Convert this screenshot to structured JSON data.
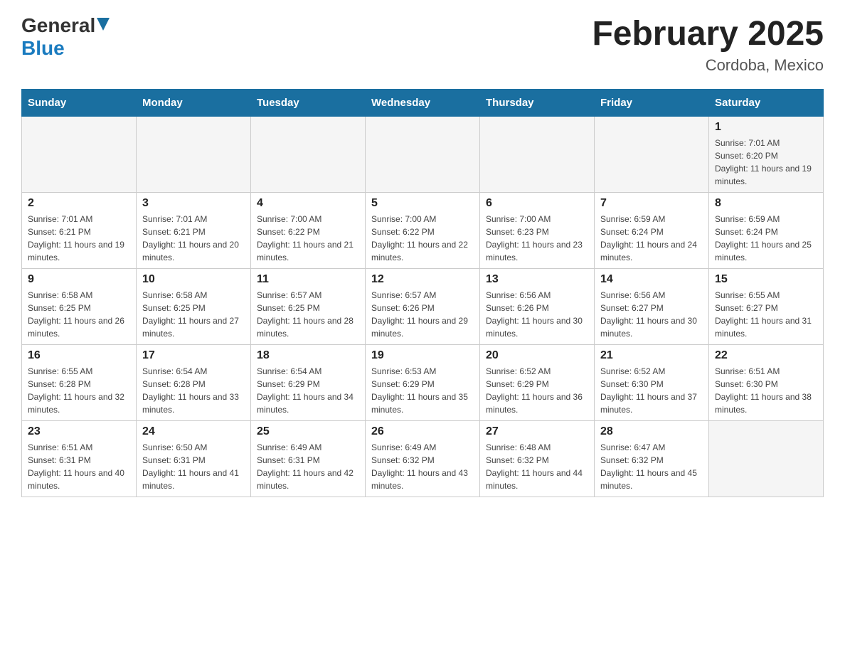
{
  "header": {
    "logo_general": "General",
    "logo_blue": "Blue",
    "title": "February 2025",
    "subtitle": "Cordoba, Mexico"
  },
  "days_of_week": [
    "Sunday",
    "Monday",
    "Tuesday",
    "Wednesday",
    "Thursday",
    "Friday",
    "Saturday"
  ],
  "weeks": [
    {
      "days": [
        {
          "number": "",
          "info": ""
        },
        {
          "number": "",
          "info": ""
        },
        {
          "number": "",
          "info": ""
        },
        {
          "number": "",
          "info": ""
        },
        {
          "number": "",
          "info": ""
        },
        {
          "number": "",
          "info": ""
        },
        {
          "number": "1",
          "info": "Sunrise: 7:01 AM\nSunset: 6:20 PM\nDaylight: 11 hours and 19 minutes."
        }
      ]
    },
    {
      "days": [
        {
          "number": "2",
          "info": "Sunrise: 7:01 AM\nSunset: 6:21 PM\nDaylight: 11 hours and 19 minutes."
        },
        {
          "number": "3",
          "info": "Sunrise: 7:01 AM\nSunset: 6:21 PM\nDaylight: 11 hours and 20 minutes."
        },
        {
          "number": "4",
          "info": "Sunrise: 7:00 AM\nSunset: 6:22 PM\nDaylight: 11 hours and 21 minutes."
        },
        {
          "number": "5",
          "info": "Sunrise: 7:00 AM\nSunset: 6:22 PM\nDaylight: 11 hours and 22 minutes."
        },
        {
          "number": "6",
          "info": "Sunrise: 7:00 AM\nSunset: 6:23 PM\nDaylight: 11 hours and 23 minutes."
        },
        {
          "number": "7",
          "info": "Sunrise: 6:59 AM\nSunset: 6:24 PM\nDaylight: 11 hours and 24 minutes."
        },
        {
          "number": "8",
          "info": "Sunrise: 6:59 AM\nSunset: 6:24 PM\nDaylight: 11 hours and 25 minutes."
        }
      ]
    },
    {
      "days": [
        {
          "number": "9",
          "info": "Sunrise: 6:58 AM\nSunset: 6:25 PM\nDaylight: 11 hours and 26 minutes."
        },
        {
          "number": "10",
          "info": "Sunrise: 6:58 AM\nSunset: 6:25 PM\nDaylight: 11 hours and 27 minutes."
        },
        {
          "number": "11",
          "info": "Sunrise: 6:57 AM\nSunset: 6:25 PM\nDaylight: 11 hours and 28 minutes."
        },
        {
          "number": "12",
          "info": "Sunrise: 6:57 AM\nSunset: 6:26 PM\nDaylight: 11 hours and 29 minutes."
        },
        {
          "number": "13",
          "info": "Sunrise: 6:56 AM\nSunset: 6:26 PM\nDaylight: 11 hours and 30 minutes."
        },
        {
          "number": "14",
          "info": "Sunrise: 6:56 AM\nSunset: 6:27 PM\nDaylight: 11 hours and 30 minutes."
        },
        {
          "number": "15",
          "info": "Sunrise: 6:55 AM\nSunset: 6:27 PM\nDaylight: 11 hours and 31 minutes."
        }
      ]
    },
    {
      "days": [
        {
          "number": "16",
          "info": "Sunrise: 6:55 AM\nSunset: 6:28 PM\nDaylight: 11 hours and 32 minutes."
        },
        {
          "number": "17",
          "info": "Sunrise: 6:54 AM\nSunset: 6:28 PM\nDaylight: 11 hours and 33 minutes."
        },
        {
          "number": "18",
          "info": "Sunrise: 6:54 AM\nSunset: 6:29 PM\nDaylight: 11 hours and 34 minutes."
        },
        {
          "number": "19",
          "info": "Sunrise: 6:53 AM\nSunset: 6:29 PM\nDaylight: 11 hours and 35 minutes."
        },
        {
          "number": "20",
          "info": "Sunrise: 6:52 AM\nSunset: 6:29 PM\nDaylight: 11 hours and 36 minutes."
        },
        {
          "number": "21",
          "info": "Sunrise: 6:52 AM\nSunset: 6:30 PM\nDaylight: 11 hours and 37 minutes."
        },
        {
          "number": "22",
          "info": "Sunrise: 6:51 AM\nSunset: 6:30 PM\nDaylight: 11 hours and 38 minutes."
        }
      ]
    },
    {
      "days": [
        {
          "number": "23",
          "info": "Sunrise: 6:51 AM\nSunset: 6:31 PM\nDaylight: 11 hours and 40 minutes."
        },
        {
          "number": "24",
          "info": "Sunrise: 6:50 AM\nSunset: 6:31 PM\nDaylight: 11 hours and 41 minutes."
        },
        {
          "number": "25",
          "info": "Sunrise: 6:49 AM\nSunset: 6:31 PM\nDaylight: 11 hours and 42 minutes."
        },
        {
          "number": "26",
          "info": "Sunrise: 6:49 AM\nSunset: 6:32 PM\nDaylight: 11 hours and 43 minutes."
        },
        {
          "number": "27",
          "info": "Sunrise: 6:48 AM\nSunset: 6:32 PM\nDaylight: 11 hours and 44 minutes."
        },
        {
          "number": "28",
          "info": "Sunrise: 6:47 AM\nSunset: 6:32 PM\nDaylight: 11 hours and 45 minutes."
        },
        {
          "number": "",
          "info": ""
        }
      ]
    }
  ]
}
